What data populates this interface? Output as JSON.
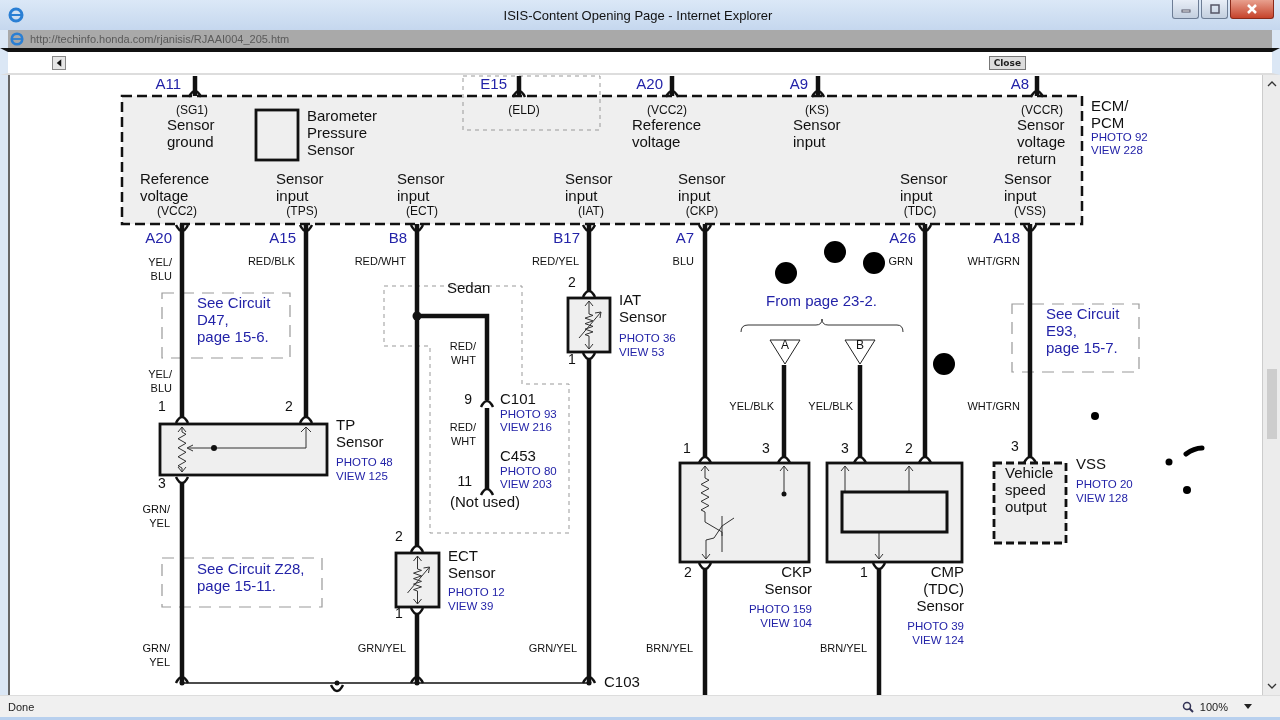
{
  "window": {
    "title": "ISIS-Content Opening Page - Internet Explorer",
    "address": "http://techinfo.honda.com/rjanisis/RJAAI004_205.htm"
  },
  "toolbar": {
    "close_button": "Close"
  },
  "diagram": {
    "ecm": {
      "name": "ECM/\nPCM",
      "photo": "PHOTO 92",
      "view": "VIEW 228"
    },
    "top_pins": [
      {
        "pin": "A11",
        "code": "(SG1)",
        "label": "Sensor\nground"
      },
      {
        "pin": "E15",
        "code": "(ELD)"
      },
      {
        "pin": "A20",
        "code": "(VCC2)",
        "label": "Reference\nvoltage"
      },
      {
        "pin": "A9",
        "code": "(KS)",
        "label": "Sensor\ninput"
      },
      {
        "pin": "A8",
        "code": "(VCCR)",
        "label": "Sensor\nvoltage\nreturn"
      }
    ],
    "barometer": "Barometer\nPressure\nSensor",
    "bottom_pins": [
      {
        "pin": "A20",
        "code": "(VCC2)",
        "label": "Reference\nvoltage"
      },
      {
        "pin": "A15",
        "code": "(TPS)",
        "label": "Sensor\ninput"
      },
      {
        "pin": "B8",
        "code": "(ECT)",
        "label": "Sensor\ninput"
      },
      {
        "pin": "B17",
        "code": "(IAT)",
        "label": "Sensor\ninput"
      },
      {
        "pin": "A7",
        "code": "(CKP)",
        "label": "Sensor\ninput"
      },
      {
        "pin": "A26",
        "code": "(TDC)",
        "label": "Sensor\ninput"
      },
      {
        "pin": "A18",
        "code": "(VSS)",
        "label": "Sensor\ninput"
      }
    ],
    "wire_labels": [
      "YEL/\nBLU",
      "RED/BLK",
      "RED/WHT",
      "RED/YEL",
      "BLU",
      "GRN",
      "WHT/GRN",
      "YEL/\nBLU",
      "RED/\nWHT",
      "RED/\nWHT",
      "YEL/BLK",
      "YEL/BLK",
      "WHT/GRN",
      "GRN/\nYEL",
      "GRN/\nYEL",
      "GRN/YEL",
      "GRN/YEL",
      "BRN/YEL",
      "BRN/YEL"
    ],
    "notes": [
      "See Circuit\nD47,\npage 15-6.",
      "See Circuit Z28,\npage 15-11.",
      "See Circuit\nE93,\npage 15-7."
    ],
    "sensors": [
      {
        "kind": "potentiometer",
        "name": "TP\nSensor",
        "photo": "PHOTO 48",
        "view": "VIEW 125",
        "pins": [
          "1",
          "2",
          "3"
        ]
      },
      {
        "kind": "thermistor",
        "name": "IAT\nSensor",
        "photo": "PHOTO 36",
        "view": "VIEW 53",
        "pins": [
          "2",
          "1"
        ]
      },
      {
        "kind": "thermistor",
        "name": "ECT\nSensor",
        "photo": "PHOTO 12",
        "view": "VIEW 39",
        "pins": [
          "2",
          "1"
        ]
      },
      {
        "kind": "hall",
        "name": "CKP\nSensor",
        "photo": "PHOTO 159",
        "view": "VIEW 104",
        "pins": [
          "1",
          "3",
          "2"
        ]
      },
      {
        "kind": "pickup",
        "name": "CMP\n(TDC)\nSensor",
        "photo": "PHOTO 39",
        "view": "VIEW 124",
        "pins": [
          "3",
          "2",
          "1"
        ]
      },
      {
        "kind": "module",
        "name": "VSS",
        "body": "Vehicle\nspeed\noutput",
        "photo": "PHOTO 20",
        "view": "VIEW 128",
        "pins": [
          "3"
        ]
      }
    ],
    "sedan": {
      "label": "Sedan",
      "connectors": [
        {
          "pin": "9",
          "name": "C101",
          "photo": "PHOTO 93",
          "view": "VIEW 216"
        },
        {
          "pin": "11",
          "name": "C453",
          "photo": "PHOTO 80",
          "view": "VIEW 203"
        }
      ],
      "note": "(Not used)"
    },
    "source": {
      "label": "From page 23-2.",
      "taps": [
        "A",
        "B"
      ]
    },
    "ground_connector": "C103"
  },
  "status_bar": {
    "status": "Done",
    "zoom": "100%"
  }
}
